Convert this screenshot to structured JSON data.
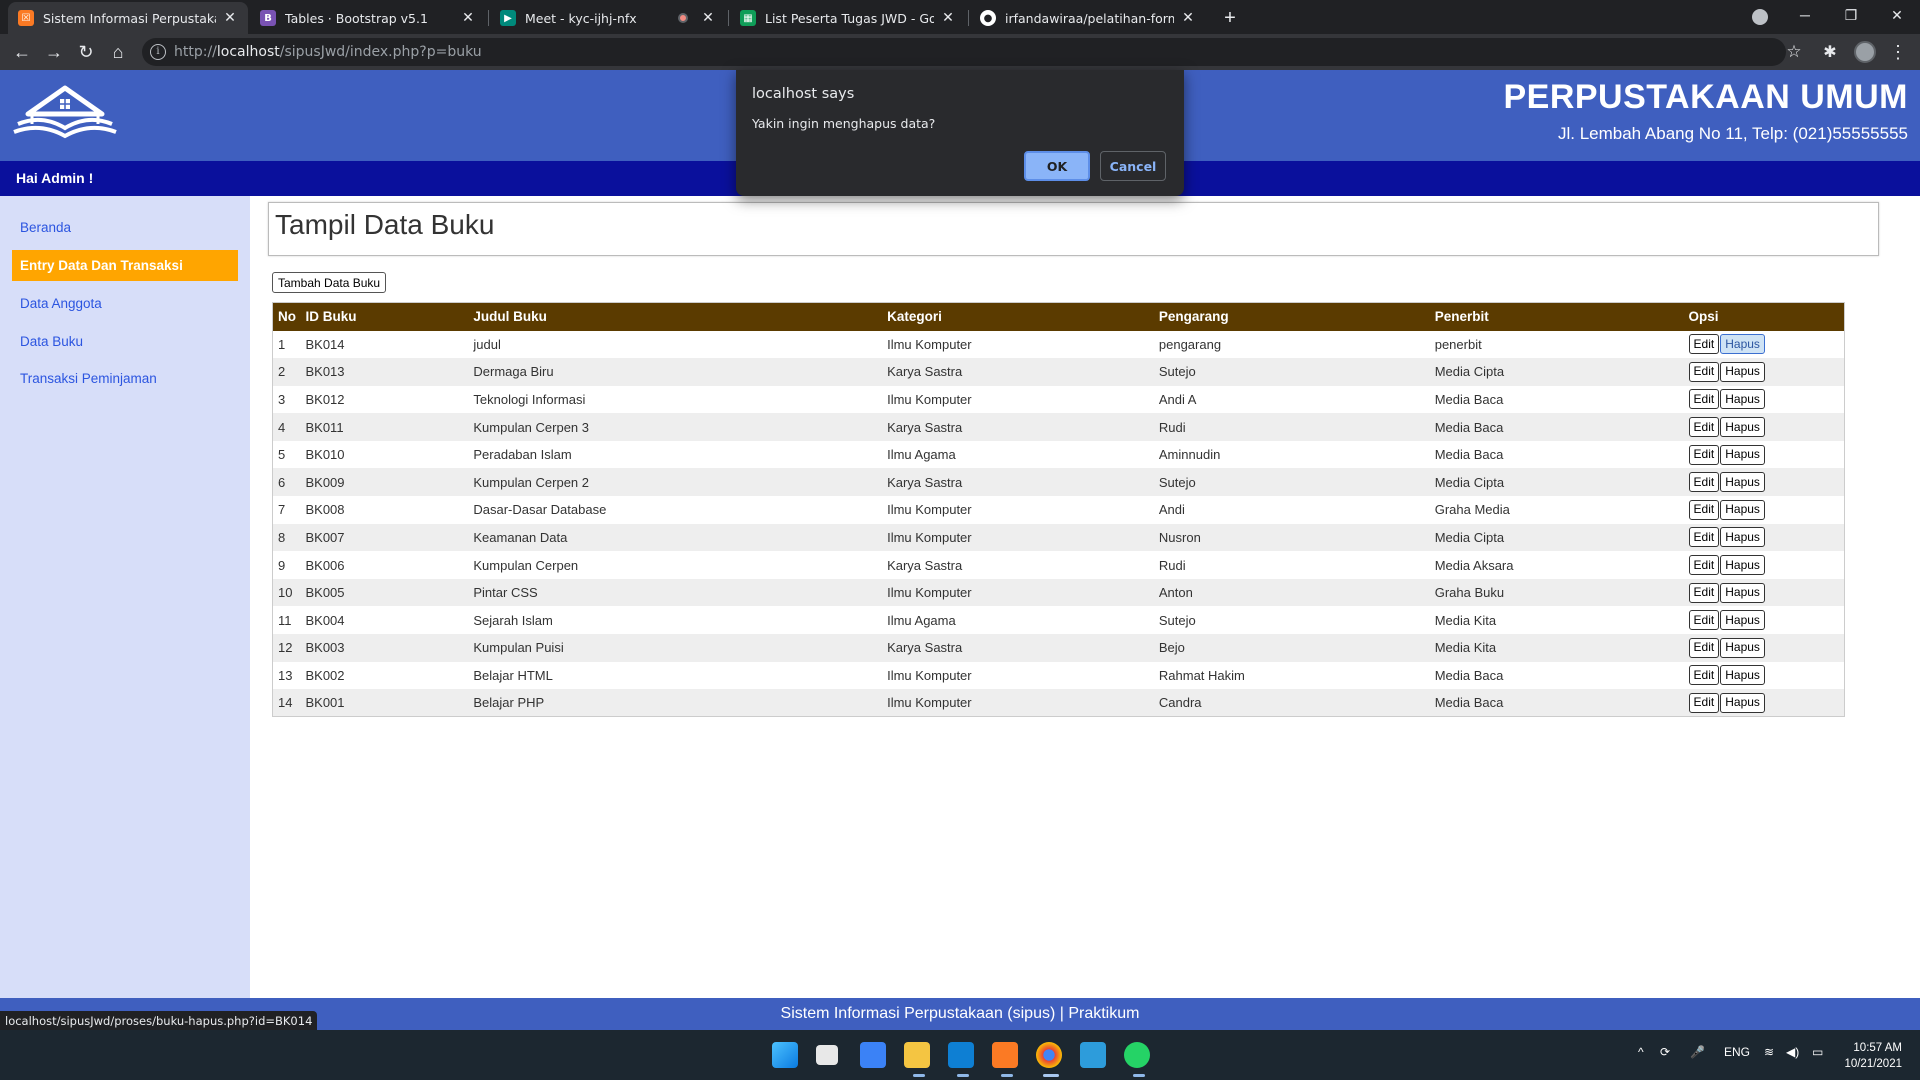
{
  "browser": {
    "tabs": [
      {
        "label": "Sistem Informasi Perpustakaan",
        "icon": "xampp-icon",
        "color": "#fb7a24"
      },
      {
        "label": "Tables · Bootstrap v5.1",
        "icon": "bootstrap-icon",
        "color": "#7952b3"
      },
      {
        "label": "Meet - kyc-ijhj-nfx",
        "icon": "meet-icon",
        "color": "#00897b"
      },
      {
        "label": "List Peserta Tugas JWD - Google",
        "icon": "sheets-icon",
        "color": "#0f9d58"
      },
      {
        "label": "irfandawiraa/pelatihan-form",
        "icon": "github-icon",
        "color": "#ffffff"
      }
    ],
    "url_prefix": "http://",
    "url_host": "localhost",
    "url_path": "/sipusJwd/index.php?p=buku",
    "status_url": "localhost/sipusJwd/proses/buku-hapus.php?id=BK014"
  },
  "header": {
    "title": "PERPUSTAKAAN UMUM",
    "address": "Jl. Lembah Abang No 11, Telp: (021)55555555",
    "greeting": "Hai Admin !"
  },
  "sidebar": {
    "items": [
      {
        "label": "Beranda"
      },
      {
        "label": "Entry Data Dan Transaksi"
      },
      {
        "label": "Data Anggota"
      },
      {
        "label": "Data Buku"
      },
      {
        "label": "Transaksi Peminjaman"
      }
    ],
    "active_color": "#ffa500"
  },
  "main": {
    "title": "Tampil Data Buku",
    "add_button": "Tambah Data Buku",
    "columns": [
      "No",
      "ID Buku",
      "Judul Buku",
      "Kategori",
      "Pengarang",
      "Penerbit",
      "Opsi"
    ],
    "edit_label": "Edit",
    "delete_label": "Hapus",
    "rows": [
      [
        "1",
        "BK014",
        "judul",
        "Ilmu Komputer",
        "pengarang",
        "penerbit"
      ],
      [
        "2",
        "BK013",
        "Dermaga Biru",
        "Karya Sastra",
        "Sutejo",
        "Media Cipta"
      ],
      [
        "3",
        "BK012",
        "Teknologi Informasi",
        "Ilmu Komputer",
        "Andi A",
        "Media Baca"
      ],
      [
        "4",
        "BK011",
        "Kumpulan Cerpen 3",
        "Karya Sastra",
        "Rudi",
        "Media Baca"
      ],
      [
        "5",
        "BK010",
        "Peradaban Islam",
        "Ilmu Agama",
        "Aminnudin",
        "Media Baca"
      ],
      [
        "6",
        "BK009",
        "Kumpulan Cerpen 2",
        "Karya Sastra",
        "Sutejo",
        "Media Cipta"
      ],
      [
        "7",
        "BK008",
        "Dasar-Dasar Database",
        "Ilmu Komputer",
        "Andi",
        "Graha Media"
      ],
      [
        "8",
        "BK007",
        "Keamanan Data",
        "Ilmu Komputer",
        "Nusron",
        "Media Cipta"
      ],
      [
        "9",
        "BK006",
        "Kumpulan Cerpen",
        "Karya Sastra",
        "Rudi",
        "Media Aksara"
      ],
      [
        "10",
        "BK005",
        "Pintar CSS",
        "Ilmu Komputer",
        "Anton",
        "Graha Buku"
      ],
      [
        "11",
        "BK004",
        "Sejarah Islam",
        "Ilmu Agama",
        "Sutejo",
        "Media Kita"
      ],
      [
        "12",
        "BK003",
        "Kumpulan Puisi",
        "Karya Sastra",
        "Bejo",
        "Media Kita"
      ],
      [
        "13",
        "BK002",
        "Belajar HTML",
        "Ilmu Komputer",
        "Rahmat Hakim",
        "Media Baca"
      ],
      [
        "14",
        "BK001",
        "Belajar PHP",
        "Ilmu Komputer",
        "Candra",
        "Media Baca"
      ]
    ],
    "header_color": "#5b3b00"
  },
  "footer": {
    "text": "Sistem Informasi Perpustakaan (sipus) | Praktikum"
  },
  "dialog": {
    "title": "localhost says",
    "message": "Yakin ingin menghapus data?",
    "ok_label": "OK",
    "cancel_label": "Cancel"
  },
  "taskbar": {
    "apps": [
      "windows-start-icon",
      "task-view-icon",
      "widgets-icon",
      "file-explorer-icon",
      "vscode-icon",
      "xampp-icon",
      "chrome-icon",
      "photos-icon",
      "whatsapp-icon"
    ],
    "language": "ENG",
    "time": "10:57 AM",
    "date": "10/21/2021"
  },
  "colors": {
    "header_blue": "#3f5fbf",
    "greet_bar": "#0a109c",
    "sidebar_bg": "#d7def9",
    "link": "#2c55e0"
  }
}
